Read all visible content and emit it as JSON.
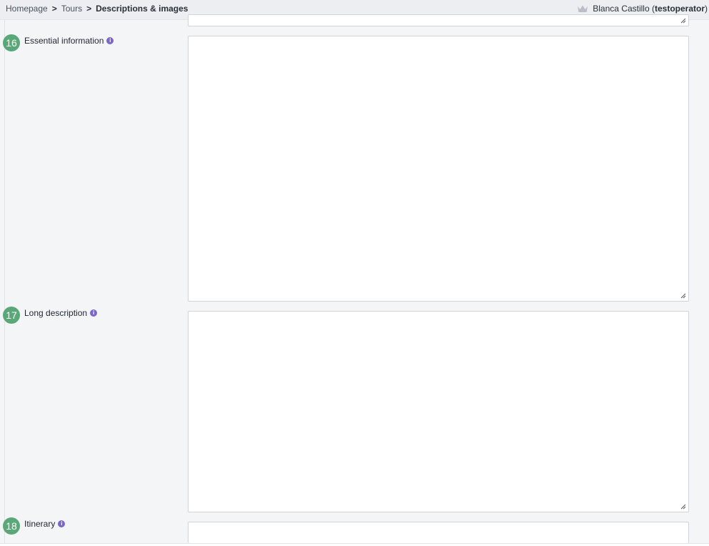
{
  "breadcrumb": {
    "items": [
      "Homepage",
      "Tours"
    ],
    "current": "Descriptions & images",
    "separator": ">"
  },
  "user": {
    "icon": "crown-icon",
    "name": "Blanca Castillo",
    "login": "testoperator",
    "open_paren": "(",
    "close_paren": ")"
  },
  "fields": [
    {
      "number": "16",
      "label": "Essential information",
      "info_icon": "info-icon",
      "value": ""
    },
    {
      "number": "17",
      "label": "Long description",
      "info_icon": "info-icon",
      "value": ""
    },
    {
      "number": "18",
      "label": "Itinerary",
      "info_icon": "info-icon",
      "value": ""
    }
  ],
  "colors": {
    "badge": "#5aa878",
    "info": "#7b66c9",
    "background": "#f4f5f7"
  }
}
